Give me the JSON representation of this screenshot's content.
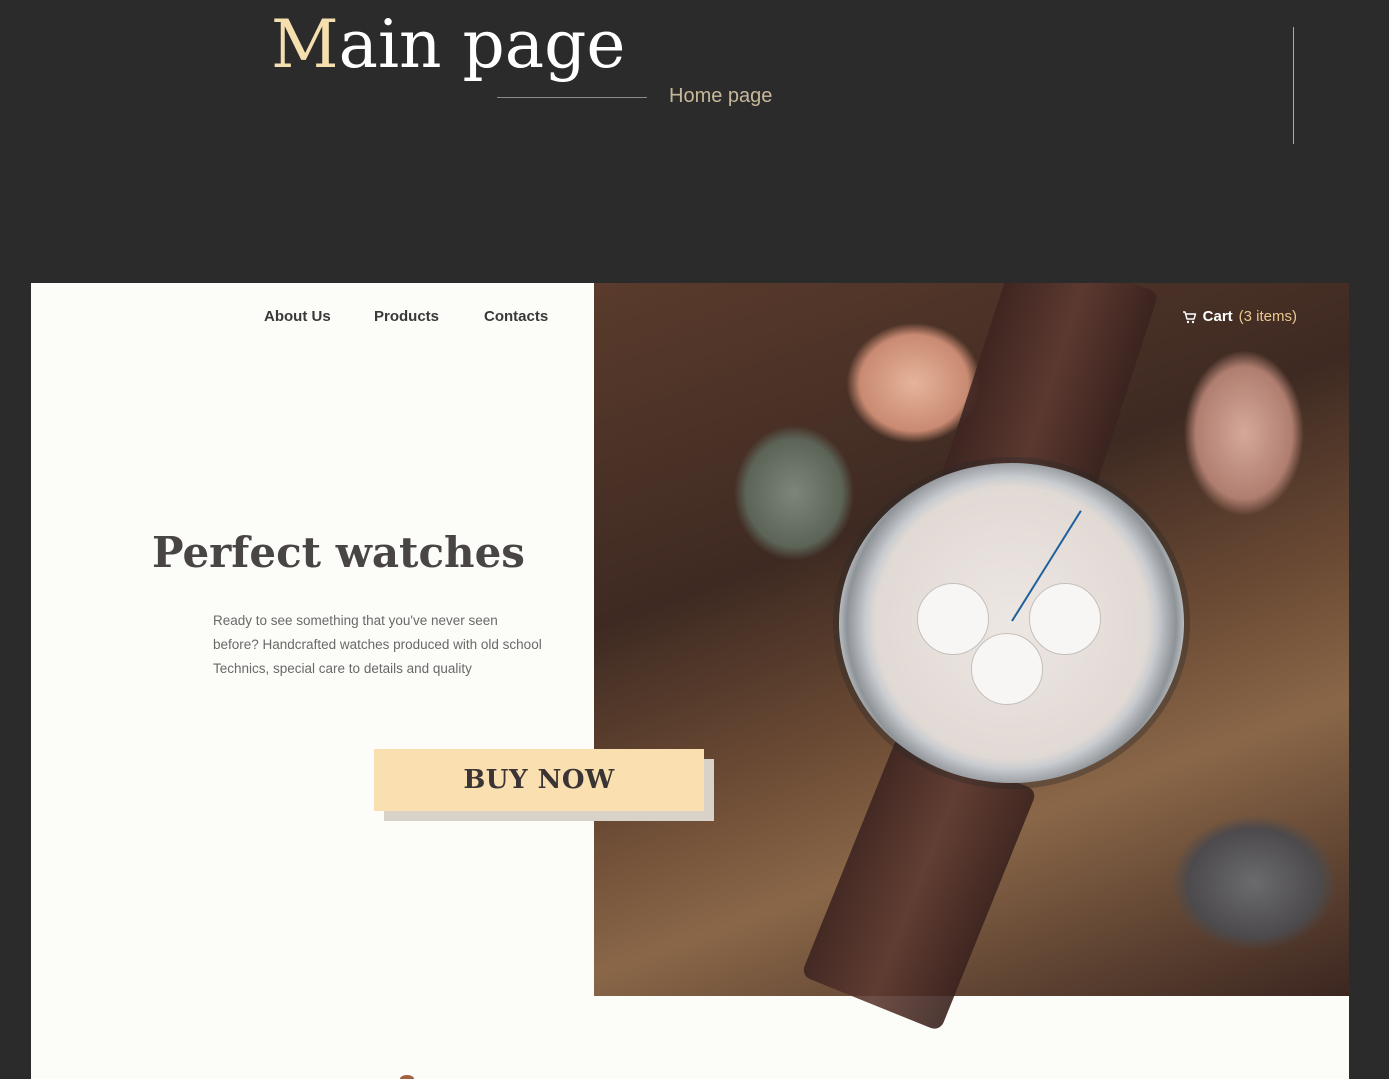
{
  "header": {
    "title_first_letter": "M",
    "title_rest": "ain page",
    "subtitle": "Home page"
  },
  "preview": {
    "nav": {
      "items": [
        {
          "label": "About Us"
        },
        {
          "label": "Products"
        },
        {
          "label": "Contacts"
        }
      ]
    },
    "cart": {
      "icon": "cart-icon",
      "label": "Cart",
      "count": "(3 items)"
    },
    "hero": {
      "heading": "Perfect watches",
      "description": "Ready to see something that you've never seen before? Handcrafted watches produced with old school Technics, special care to details and quality",
      "button_label": "BUY NOW"
    }
  },
  "colors": {
    "background": "#2b2b2c",
    "accent": "#f6dfaf",
    "button": "#fadfb0",
    "card": "#fcfdf9"
  }
}
